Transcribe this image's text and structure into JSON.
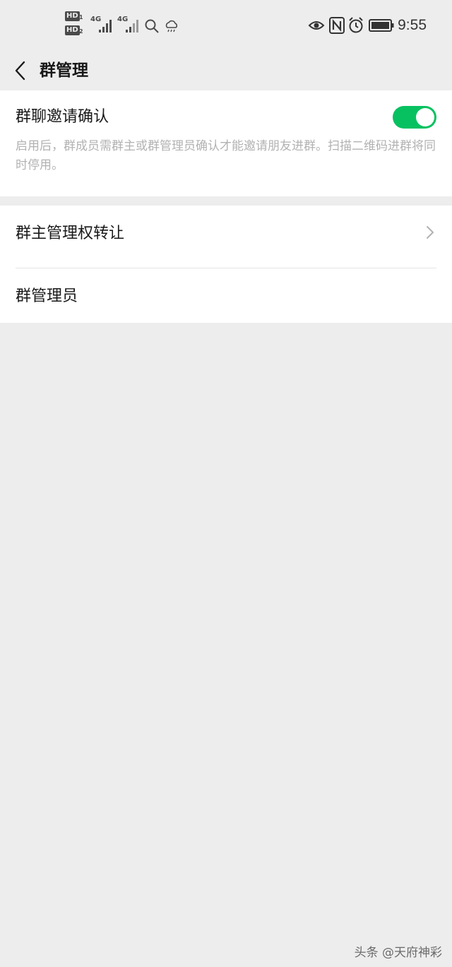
{
  "status_bar": {
    "sim1_label": "HD",
    "sim1_num": "1",
    "sim2_label": "HD",
    "sim2_num": "2",
    "net1": "4G",
    "net2": "4G",
    "time": "9:55",
    "icons": [
      "eye-comfort-icon",
      "nfc-icon",
      "alarm-icon",
      "battery-icon",
      "search-icon",
      "weather-icon"
    ]
  },
  "header": {
    "title": "群管理"
  },
  "invite_confirm": {
    "label": "群聊邀请确认",
    "description": "启用后，群成员需群主或群管理员确认才能邀请朋友进群。扫描二维码进群将同时停用。",
    "enabled": true,
    "toggle_color": "#07c160"
  },
  "transfer_owner": {
    "label": "群主管理权转让"
  },
  "admins": {
    "label": "群管理员"
  },
  "watermark": {
    "text": "头条 @天府神彩"
  }
}
